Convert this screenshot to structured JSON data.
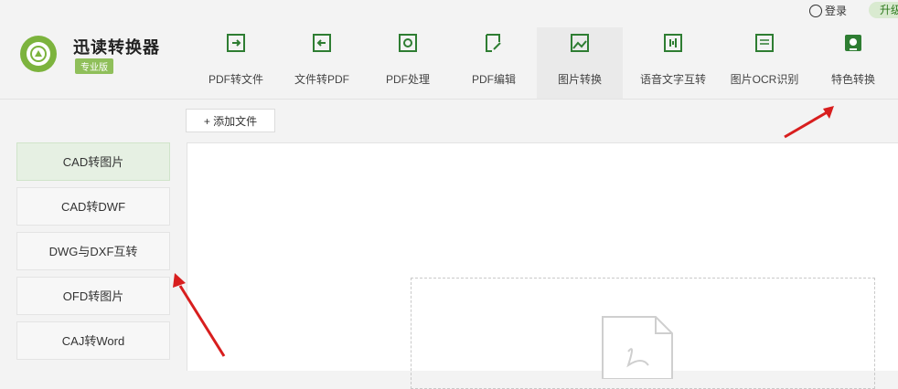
{
  "app": {
    "title": "迅读转换器",
    "edition": "专业版"
  },
  "topbar": {
    "login": "登录",
    "upgrade": "升级"
  },
  "tabs": [
    {
      "label": "PDF转文件",
      "icon": "pdf-to-file-icon"
    },
    {
      "label": "文件转PDF",
      "icon": "file-to-pdf-icon"
    },
    {
      "label": "PDF处理",
      "icon": "pdf-process-icon"
    },
    {
      "label": "PDF编辑",
      "icon": "pdf-edit-icon"
    },
    {
      "label": "图片转换",
      "icon": "image-convert-icon"
    },
    {
      "label": "语音文字互转",
      "icon": "voice-text-icon"
    },
    {
      "label": "图片OCR识别",
      "icon": "ocr-icon"
    },
    {
      "label": "特色转换",
      "icon": "special-convert-icon"
    }
  ],
  "toolbar": {
    "add_file": "+ 添加文件"
  },
  "sidebar": {
    "items": [
      {
        "label": "CAD转图片",
        "active": true
      },
      {
        "label": "CAD转DWF"
      },
      {
        "label": "DWG与DXF互转"
      },
      {
        "label": "OFD转图片"
      },
      {
        "label": "CAJ转Word"
      }
    ]
  },
  "colors": {
    "brand_green": "#2e7d32",
    "accent_light": "#e6f0e3",
    "arrow_red": "#d81e1e"
  }
}
